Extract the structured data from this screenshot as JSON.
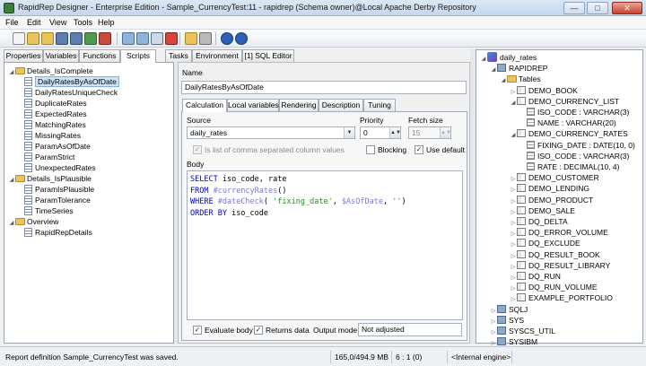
{
  "window": {
    "title": "RapidRep Designer - Enterprise Edition - Sample_CurrencyTest:11 - rapidrep (Schema owner)@Local Apache Derby Repository",
    "minimize_glyph": "—",
    "maximize_glyph": "□",
    "close_glyph": "✕"
  },
  "menu": [
    "File",
    "Edit",
    "View",
    "Tools",
    "Help"
  ],
  "left_tabs": [
    "Properties",
    "Variables",
    "Functions",
    "Scripts",
    "Tasks",
    "Environment",
    "[1] SQL Editor"
  ],
  "tree": {
    "groups": [
      {
        "name": "Details_IsComplete",
        "items": [
          "DailyRatesByAsOfDate",
          "DailyRatesUniqueCheck",
          "DuplicateRates",
          "ExpectedRates",
          "MatchingRates",
          "MissingRates",
          "ParamAsOfDate",
          "ParamStrict",
          "UnexpectedRates"
        ]
      },
      {
        "name": "Details_IsPlausible",
        "items": [
          "ParamIsPlausible",
          "ParamTolerance",
          "TimeSeries"
        ]
      },
      {
        "name": "Overview",
        "items": [
          "RapidRepDetails"
        ]
      }
    ],
    "selected": "DailyRatesByAsOfDate"
  },
  "editor": {
    "name_label": "Name",
    "name_value": "DailyRatesByAsOfDate",
    "tabs": [
      "Calculation",
      "Local variables",
      "Rendering",
      "Description",
      "Tuning"
    ],
    "source_label": "Source",
    "source_value": "daily_rates",
    "priority_label": "Priority",
    "priority_value": "0",
    "fetch_label": "Fetch size",
    "fetch_value": "15",
    "comma_list_label": "Is list of comma separated column values",
    "blocking_label": "Blocking",
    "use_default_label": "Use default",
    "body_label": "Body",
    "code_lines": [
      [
        {
          "t": "SELECT",
          "c": "kw"
        },
        {
          "t": " iso_code, rate",
          "c": "fn"
        }
      ],
      [
        {
          "t": "FROM",
          "c": "kw"
        },
        {
          "t": " ",
          "c": "fn"
        },
        {
          "t": "#currencyRates",
          "c": "ph"
        },
        {
          "t": "()",
          "c": "fn"
        }
      ],
      [
        {
          "t": "WHERE",
          "c": "kw"
        },
        {
          "t": " ",
          "c": "fn"
        },
        {
          "t": "#dateCheck",
          "c": "ph"
        },
        {
          "t": "( ",
          "c": "fn"
        },
        {
          "t": "'fixing_date'",
          "c": "str"
        },
        {
          "t": ", ",
          "c": "fn"
        },
        {
          "t": "$AsOfDate",
          "c": "ph"
        },
        {
          "t": ", ",
          "c": "fn"
        },
        {
          "t": "''",
          "c": "str"
        },
        {
          "t": ")",
          "c": "fn"
        }
      ],
      [
        {
          "t": "ORDER BY",
          "c": "kw"
        },
        {
          "t": " iso_code",
          "c": "fn"
        }
      ]
    ],
    "evaluate_label": "Evaluate body",
    "returns_label": "Returns data",
    "output_mode_label": "Output mode",
    "output_mode_value": "Not adjusted",
    "check_glyph": "✓"
  },
  "db_tree": {
    "root": "daily_rates",
    "schema": "RAPIDREP",
    "tables_label": "Tables",
    "rows": [
      {
        "label": "DEMO_BOOK",
        "indent": 3,
        "icon": "table",
        "exp": "▷"
      },
      {
        "label": "DEMO_CURRENCY_LIST",
        "indent": 3,
        "icon": "table",
        "exp": "◢"
      },
      {
        "label": "ISO_CODE : VARCHAR(3)",
        "indent": 4,
        "icon": "col",
        "exp": ""
      },
      {
        "label": "NAME : VARCHAR(20)",
        "indent": 4,
        "icon": "col",
        "exp": ""
      },
      {
        "label": "DEMO_CURRENCY_RATES",
        "indent": 3,
        "icon": "table",
        "exp": "◢"
      },
      {
        "label": "FIXING_DATE : DATE(10, 0)",
        "indent": 4,
        "icon": "col",
        "exp": ""
      },
      {
        "label": "ISO_CODE : VARCHAR(3)",
        "indent": 4,
        "icon": "col",
        "exp": ""
      },
      {
        "label": "RATE : DECIMAL(10, 4)",
        "indent": 4,
        "icon": "col",
        "exp": ""
      },
      {
        "label": "DEMO_CUSTOMER",
        "indent": 3,
        "icon": "table",
        "exp": "▷"
      },
      {
        "label": "DEMO_LENDING",
        "indent": 3,
        "icon": "table",
        "exp": "▷"
      },
      {
        "label": "DEMO_PRODUCT",
        "indent": 3,
        "icon": "table",
        "exp": "▷"
      },
      {
        "label": "DEMO_SALE",
        "indent": 3,
        "icon": "table",
        "exp": "▷"
      },
      {
        "label": "DQ_DELTA",
        "indent": 3,
        "icon": "table",
        "exp": "▷"
      },
      {
        "label": "DQ_ERROR_VOLUME",
        "indent": 3,
        "icon": "table",
        "exp": "▷"
      },
      {
        "label": "DQ_EXCLUDE",
        "indent": 3,
        "icon": "table",
        "exp": "▷"
      },
      {
        "label": "DQ_RESULT_BOOK",
        "indent": 3,
        "icon": "table",
        "exp": "▷"
      },
      {
        "label": "DQ_RESULT_LIBRARY",
        "indent": 3,
        "icon": "table",
        "exp": "▷"
      },
      {
        "label": "DQ_RUN",
        "indent": 3,
        "icon": "table",
        "exp": "▷"
      },
      {
        "label": "DQ_RUN_VOLUME",
        "indent": 3,
        "icon": "table",
        "exp": "▷"
      },
      {
        "label": "EXAMPLE_PORTFOLIO",
        "indent": 3,
        "icon": "table",
        "exp": "▷"
      },
      {
        "label": "SQLJ",
        "indent": 1,
        "icon": "schema",
        "exp": "▷"
      },
      {
        "label": "SYS",
        "indent": 1,
        "icon": "schema",
        "exp": "▷"
      },
      {
        "label": "SYSCS_UTIL",
        "indent": 1,
        "icon": "schema",
        "exp": "▷"
      },
      {
        "label": "SYSIBM",
        "indent": 1,
        "icon": "schema",
        "exp": "▷"
      }
    ]
  },
  "status": {
    "message": "Report definition Sample_CurrencyTest was saved.",
    "memory": "165,0/494,9 MB",
    "position": "6 : 1 (0)",
    "engine": "<Internal engine>"
  }
}
